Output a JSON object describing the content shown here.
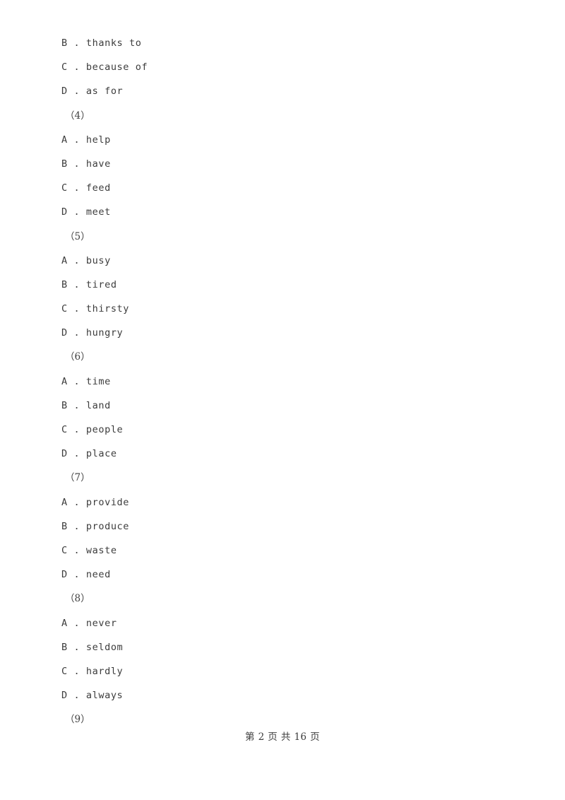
{
  "document": {
    "page_background": "#ffffff",
    "text_color": "#3c3c3c",
    "option_separator": " . "
  },
  "blocks": [
    {
      "kind": "option",
      "letter": "B",
      "text": "thanks to"
    },
    {
      "kind": "option",
      "letter": "C",
      "text": "because of"
    },
    {
      "kind": "option",
      "letter": "D",
      "text": "as for"
    },
    {
      "kind": "group",
      "marker": "（4）"
    },
    {
      "kind": "option",
      "letter": "A",
      "text": "help"
    },
    {
      "kind": "option",
      "letter": "B",
      "text": "have"
    },
    {
      "kind": "option",
      "letter": "C",
      "text": "feed"
    },
    {
      "kind": "option",
      "letter": "D",
      "text": "meet"
    },
    {
      "kind": "group",
      "marker": "（5）"
    },
    {
      "kind": "option",
      "letter": "A",
      "text": "busy"
    },
    {
      "kind": "option",
      "letter": "B",
      "text": "tired"
    },
    {
      "kind": "option",
      "letter": "C",
      "text": "thirsty"
    },
    {
      "kind": "option",
      "letter": "D",
      "text": "hungry"
    },
    {
      "kind": "group",
      "marker": "（6）"
    },
    {
      "kind": "option",
      "letter": "A",
      "text": "time"
    },
    {
      "kind": "option",
      "letter": "B",
      "text": "land"
    },
    {
      "kind": "option",
      "letter": "C",
      "text": "people"
    },
    {
      "kind": "option",
      "letter": "D",
      "text": "place"
    },
    {
      "kind": "group",
      "marker": "（7）"
    },
    {
      "kind": "option",
      "letter": "A",
      "text": "provide"
    },
    {
      "kind": "option",
      "letter": "B",
      "text": "produce"
    },
    {
      "kind": "option",
      "letter": "C",
      "text": "waste"
    },
    {
      "kind": "option",
      "letter": "D",
      "text": "need"
    },
    {
      "kind": "group",
      "marker": "（8）"
    },
    {
      "kind": "option",
      "letter": "A",
      "text": "never"
    },
    {
      "kind": "option",
      "letter": "B",
      "text": "seldom"
    },
    {
      "kind": "option",
      "letter": "C",
      "text": "hardly"
    },
    {
      "kind": "option",
      "letter": "D",
      "text": "always"
    },
    {
      "kind": "group",
      "marker": "（9）"
    }
  ],
  "footer": {
    "text": "第 2 页 共 16 页",
    "page_number": "2",
    "total_pages": "16"
  }
}
